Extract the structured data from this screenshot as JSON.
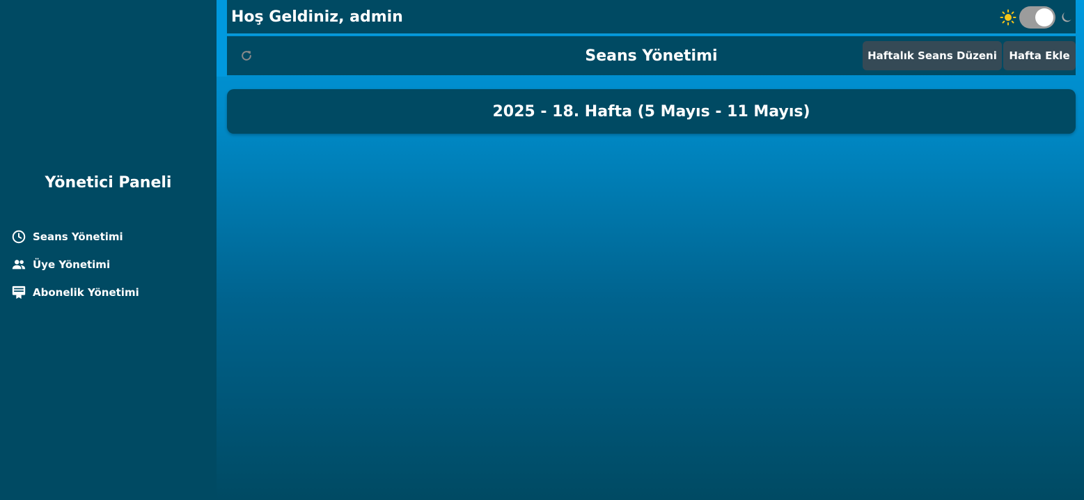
{
  "sidebar": {
    "title": "Yönetici Paneli",
    "items": [
      {
        "label": "Seans Yönetimi",
        "icon": "clock-icon"
      },
      {
        "label": "Üye Yönetimi",
        "icon": "users-icon"
      },
      {
        "label": "Abonelik Yönetimi",
        "icon": "subscription-icon"
      }
    ]
  },
  "header": {
    "welcome": "Hoş Geldiniz, admin",
    "theme_toggle": {
      "state": "on",
      "sun_icon": "sun-icon",
      "moon_icon": "moon-icon"
    }
  },
  "toolbar": {
    "title": "Seans Yönetimi",
    "refresh_icon": "refresh-icon",
    "weekly_schedule_label": "Haftalık Seans Düzeni",
    "add_week_label": "Hafta Ekle"
  },
  "weeks": [
    {
      "label": "2025 - 18. Hafta (5 Mayıs - 11 Mayıs)"
    }
  ],
  "colors": {
    "panel": "#004a63",
    "accent": "#0099de",
    "button": "#354a56",
    "sun": "#f5c518"
  }
}
